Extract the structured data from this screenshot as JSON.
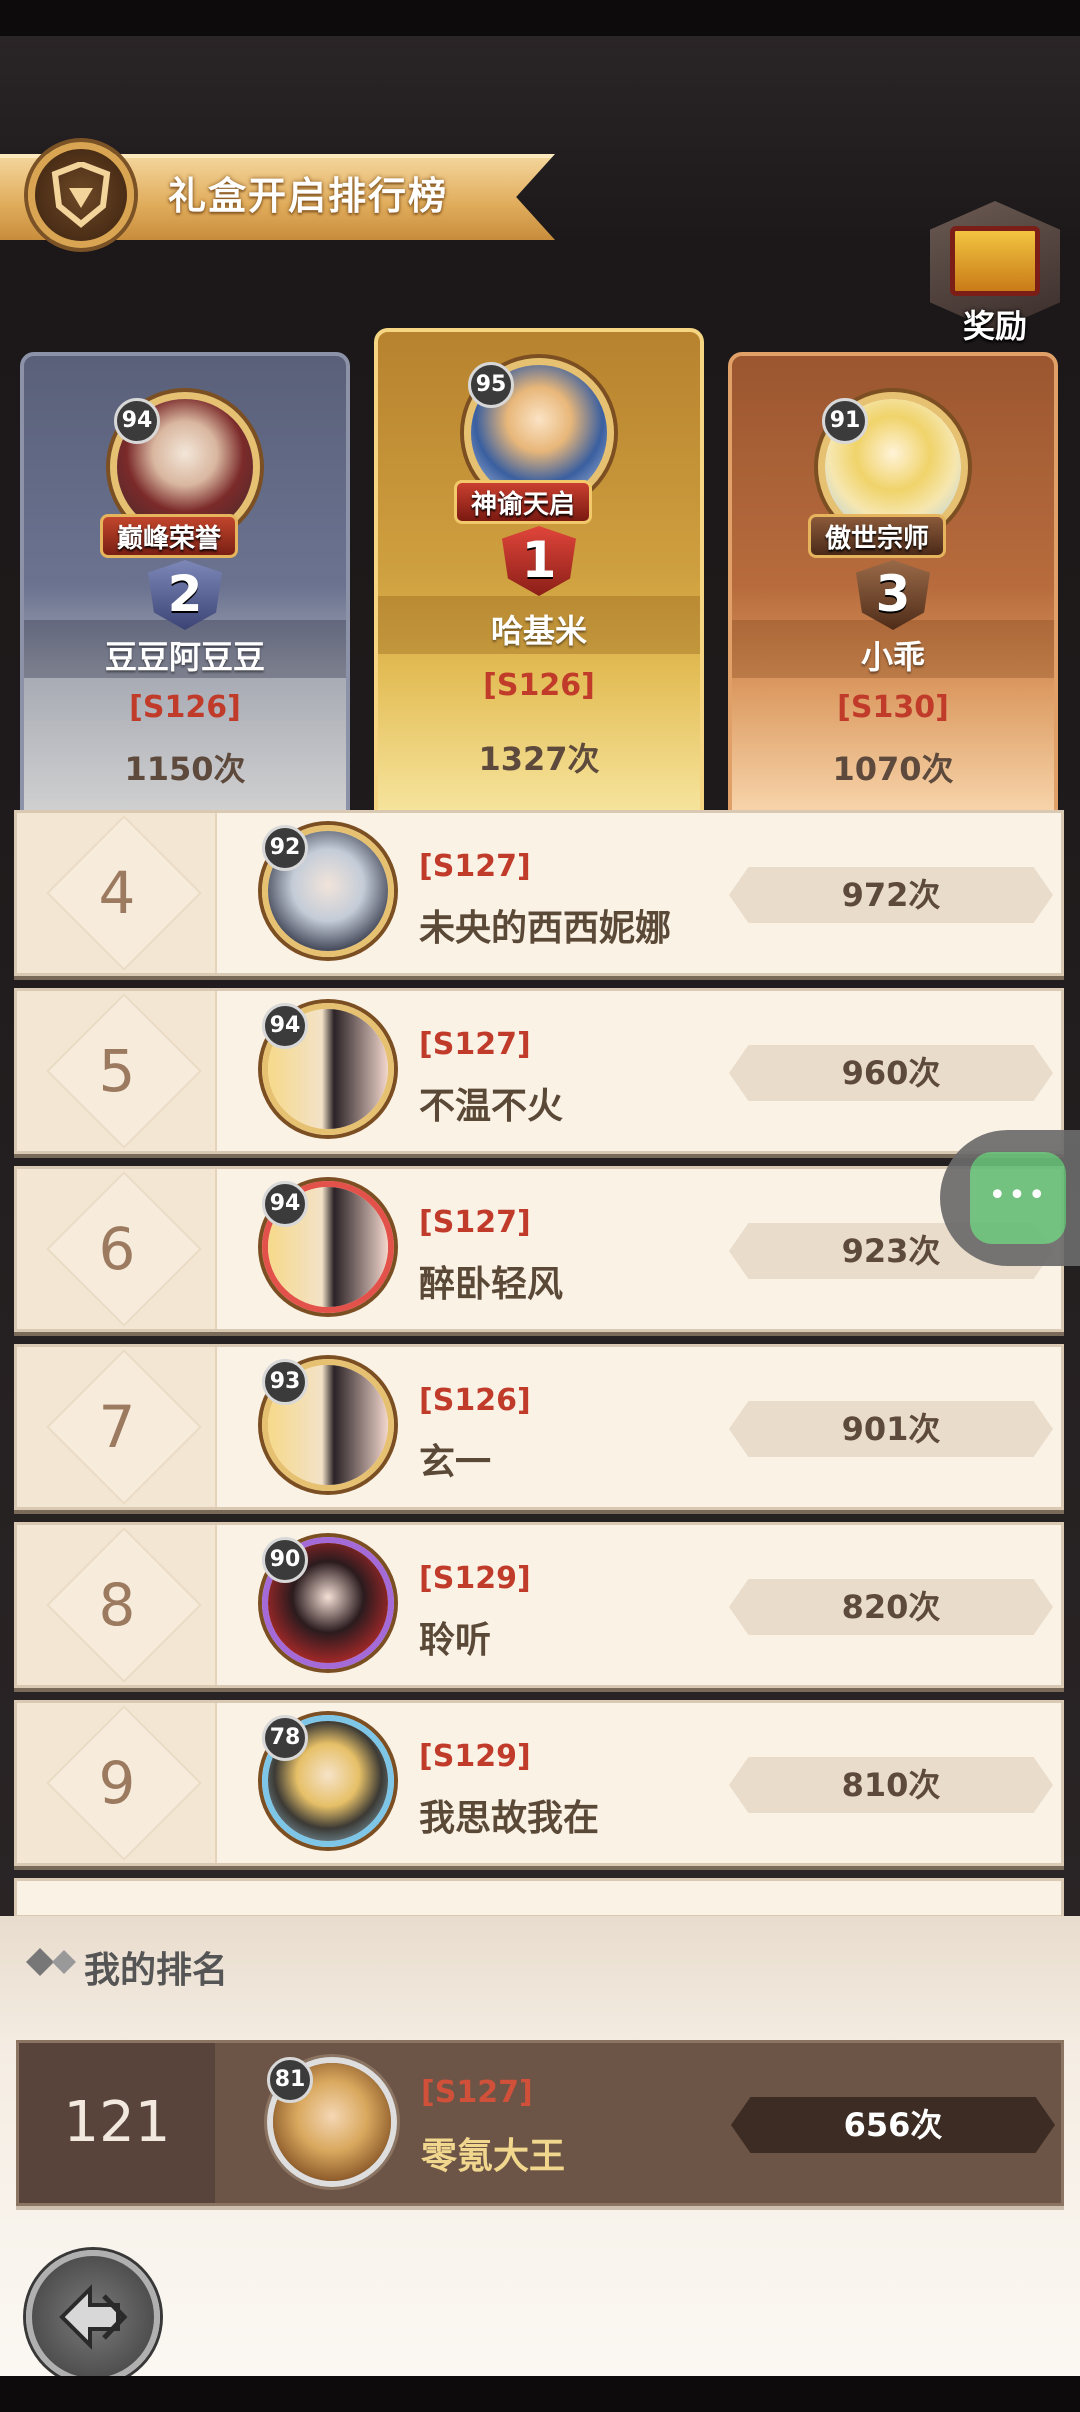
{
  "header": {
    "title": "礼盒开启排行榜",
    "reward_label": "奖励",
    "emblem_icon": "shield-emblem-icon"
  },
  "podium": [
    {
      "rank": "2",
      "name": "豆豆阿豆豆",
      "server": "[S126]",
      "count": "1150次",
      "level": "94",
      "title": "巅峰荣誉"
    },
    {
      "rank": "1",
      "name": "哈基米",
      "server": "[S126]",
      "count": "1327次",
      "level": "95",
      "title": "神谕天启"
    },
    {
      "rank": "3",
      "name": "小乖",
      "server": "[S130]",
      "count": "1070次",
      "level": "91",
      "title": "傲世宗师"
    }
  ],
  "list": [
    {
      "rank": "4",
      "server": "[S127]",
      "name": "未央的西西妮娜",
      "count": "972次",
      "level": "92"
    },
    {
      "rank": "5",
      "server": "[S127]",
      "name": "不温不火",
      "count": "960次",
      "level": "94"
    },
    {
      "rank": "6",
      "server": "[S127]",
      "name": "醉卧轻风",
      "count": "923次",
      "level": "94"
    },
    {
      "rank": "7",
      "server": "[S126]",
      "name": "玄一",
      "count": "901次",
      "level": "93"
    },
    {
      "rank": "8",
      "server": "[S129]",
      "name": "聆听",
      "count": "820次",
      "level": "90"
    },
    {
      "rank": "9",
      "server": "[S129]",
      "name": "我思故我在",
      "count": "810次",
      "level": "78"
    }
  ],
  "my_rank": {
    "label": "我的排名",
    "rank": "121",
    "server": "[S127]",
    "name": "零氪大王",
    "count": "656次",
    "level": "81"
  },
  "floating_chat": {
    "label": "•••"
  },
  "colors": {
    "server_red": "#c13b2b",
    "gold": "#e3bd56",
    "silver": "#6b7391",
    "bronze": "#b86c3d"
  }
}
